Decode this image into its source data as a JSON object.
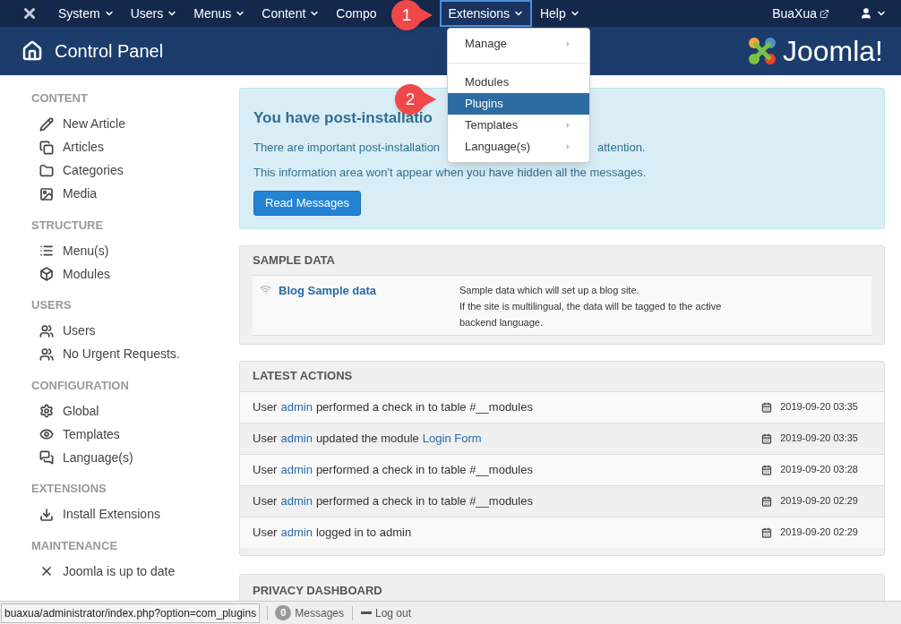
{
  "navbar": {
    "items": [
      {
        "label": "System",
        "selected": false,
        "caret": true
      },
      {
        "label": "Users",
        "selected": false,
        "caret": true
      },
      {
        "label": "Menus",
        "selected": false,
        "caret": true
      },
      {
        "label": "Content",
        "selected": false,
        "caret": true
      },
      {
        "label": "Compo",
        "selected": false,
        "caret": false
      },
      {
        "label": "Extensions",
        "selected": true,
        "caret": true
      },
      {
        "label": "Help",
        "selected": false,
        "caret": true
      }
    ],
    "site_link": "BuaXua"
  },
  "header": {
    "title": "Control Panel",
    "logo_text": "Joomla!"
  },
  "dropdown": {
    "items": [
      {
        "kind": "item",
        "label": "Manage",
        "submenu": true,
        "selected": false
      },
      {
        "kind": "divider"
      },
      {
        "kind": "item",
        "label": "Modules",
        "submenu": false,
        "selected": false
      },
      {
        "kind": "item",
        "label": "Plugins",
        "submenu": false,
        "selected": true
      },
      {
        "kind": "item",
        "label": "Templates",
        "submenu": true,
        "selected": false
      },
      {
        "kind": "item",
        "label": "Language(s)",
        "submenu": true,
        "selected": false
      }
    ]
  },
  "callouts": [
    {
      "label": "1"
    },
    {
      "label": "2"
    }
  ],
  "sidebar": {
    "sections": [
      {
        "heading": "CONTENT",
        "items": [
          {
            "label": "New Article"
          },
          {
            "label": "Articles"
          },
          {
            "label": "Categories"
          },
          {
            "label": "Media"
          }
        ]
      },
      {
        "heading": "STRUCTURE",
        "items": [
          {
            "label": "Menu(s)"
          },
          {
            "label": "Modules"
          }
        ]
      },
      {
        "heading": "USERS",
        "items": [
          {
            "label": "Users"
          },
          {
            "label": "No Urgent Requests."
          }
        ]
      },
      {
        "heading": "CONFIGURATION",
        "items": [
          {
            "label": "Global"
          },
          {
            "label": "Templates"
          },
          {
            "label": "Language(s)"
          }
        ]
      },
      {
        "heading": "EXTENSIONS",
        "items": [
          {
            "label": "Install Extensions"
          }
        ]
      },
      {
        "heading": "MAINTENANCE",
        "items": [
          {
            "label": "Joomla is up to date"
          }
        ]
      }
    ]
  },
  "alert": {
    "title": "You have post-installatio",
    "line_1_start": "There are important post-installation",
    "line_1_end": "attention.",
    "line_2": "This information area won't appear when you have hidden all the messages.",
    "button": "Read Messages"
  },
  "sample_data": {
    "heading": "SAMPLE DATA",
    "title": "Blog Sample data",
    "description": [
      "Sample data which will set up a blog site.",
      "If the site is multilingual, the data will be tagged to the active",
      "backend language."
    ]
  },
  "latest_actions": {
    "heading": "LATEST ACTIONS",
    "rows": [
      {
        "parts": [
          {
            "text": "User",
            "link": false
          },
          {
            "text": "admin",
            "link": true
          },
          {
            "text": "performed a check in to table #__modules",
            "link": false
          }
        ],
        "date": "2019-09-20 03:35"
      },
      {
        "parts": [
          {
            "text": "User",
            "link": false
          },
          {
            "text": "admin",
            "link": true
          },
          {
            "text": "updated the module",
            "link": false
          },
          {
            "text": "Login Form",
            "link": true
          }
        ],
        "date": "2019-09-20 03:35"
      },
      {
        "parts": [
          {
            "text": "User",
            "link": false
          },
          {
            "text": "admin",
            "link": true
          },
          {
            "text": "performed a check in to table #__modules",
            "link": false
          }
        ],
        "date": "2019-09-20 03:28"
      },
      {
        "parts": [
          {
            "text": "User",
            "link": false
          },
          {
            "text": "admin",
            "link": true
          },
          {
            "text": "performed a check in to table #__modules",
            "link": false
          }
        ],
        "date": "2019-09-20 02:29"
      },
      {
        "parts": [
          {
            "text": "User",
            "link": false
          },
          {
            "text": "admin",
            "link": true
          },
          {
            "text": "logged in to admin",
            "link": false
          }
        ],
        "date": "2019-09-20 02:29"
      }
    ]
  },
  "privacy": {
    "heading": "PRIVACY DASHBOARD"
  },
  "status_bar": {
    "url": "buaxua/administrator/index.php?option=com_plugins",
    "messages_count": "0",
    "messages_label": "Messages",
    "logout": "Log out"
  }
}
